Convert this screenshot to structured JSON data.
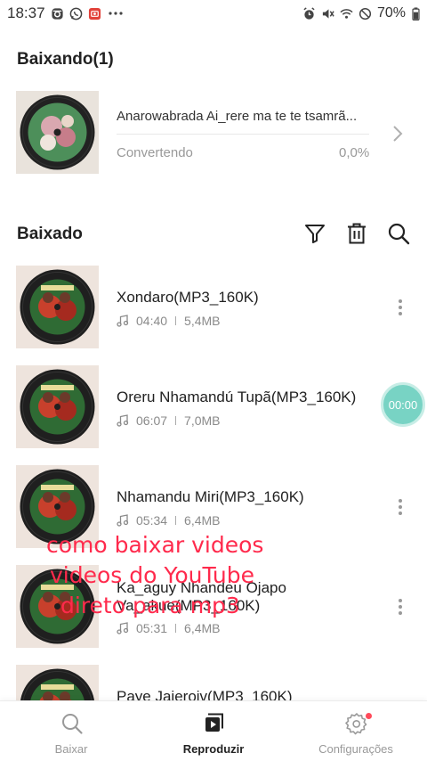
{
  "status_bar": {
    "time": "18:37",
    "battery": "70%",
    "left_icons": [
      "instagram-icon",
      "whatsapp-icon",
      "photo-notification-icon",
      "more-icon"
    ],
    "right_icons": [
      "alarm-icon",
      "mute-icon",
      "wifi-icon",
      "no-disturb-icon",
      "battery-icon"
    ]
  },
  "downloading": {
    "title": "Baixando(1)",
    "item": {
      "name": "Anarowabrada Ai_rere ma te te tsamrã...",
      "status": "Convertendo",
      "progress": "0,0%"
    }
  },
  "downloaded": {
    "title": "Baixado",
    "toolbar": [
      "filter-icon",
      "trash-icon",
      "search-icon"
    ],
    "items": [
      {
        "title": "Xondaro(MP3_160K)",
        "duration": "04:40",
        "size": "5,4MB"
      },
      {
        "title": "Oreru Nhamandú Tupã(MP3_160K)",
        "duration": "06:07",
        "size": "7,0MB"
      },
      {
        "title": "Nhamandu Miri(MP3_160K)",
        "duration": "05:34",
        "size": "6,4MB"
      },
      {
        "title": "Ka_aguy Nhandeu Ojapo Va_akue(MP3_160K)",
        "title_line1": "Ka_aguy Nhandeu Ojapo",
        "title_line2": "Va_akue(MP3_160K)",
        "duration": "05:31",
        "size": "6,4MB"
      },
      {
        "title": "Paye Jajeroiv(MP3_160K)"
      }
    ]
  },
  "timer_bubble": "00:00",
  "overlay_caption": {
    "line1": "como baixar videos",
    "line2": "videos do YouTube",
    "line3": "direto para mp3"
  },
  "bottom_nav": [
    {
      "label": "Baixar",
      "icon": "search-icon",
      "active": false
    },
    {
      "label": "Reproduzir",
      "icon": "play-icon",
      "active": true
    },
    {
      "label": "Configurações",
      "icon": "gear-icon",
      "active": false
    }
  ],
  "colors": {
    "accent_teal": "#78d3c4",
    "caption_red": "#ff2a4c",
    "badge_red": "#ff4a5a"
  }
}
